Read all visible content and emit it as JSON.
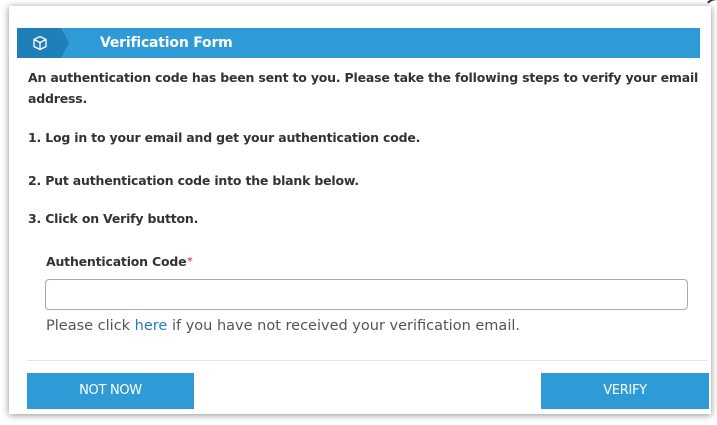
{
  "dialog": {
    "title": "Verification Form",
    "header_icon": "cube-icon",
    "colors": {
      "accent": "#2f9bd6",
      "accent_dark": "#1f7fb8",
      "text": "#333333",
      "required": "#e84c3d",
      "link": "#1f7fb8"
    }
  },
  "intro": {
    "text": "An authentication code has been sent to you. Please take the following steps to verify your email address."
  },
  "steps": [
    "1. Log in to your email and get your authentication code.",
    "2. Put authentication code into the blank below.",
    "3. Click on Verify button."
  ],
  "field": {
    "label": "Authentication Code",
    "required_marker": "*",
    "value": ""
  },
  "resend": {
    "prefix": "Please click ",
    "link": "here",
    "suffix": " if you have not received your verification email."
  },
  "buttons": {
    "not_now": "NOT NOW",
    "verify": "VERIFY"
  }
}
